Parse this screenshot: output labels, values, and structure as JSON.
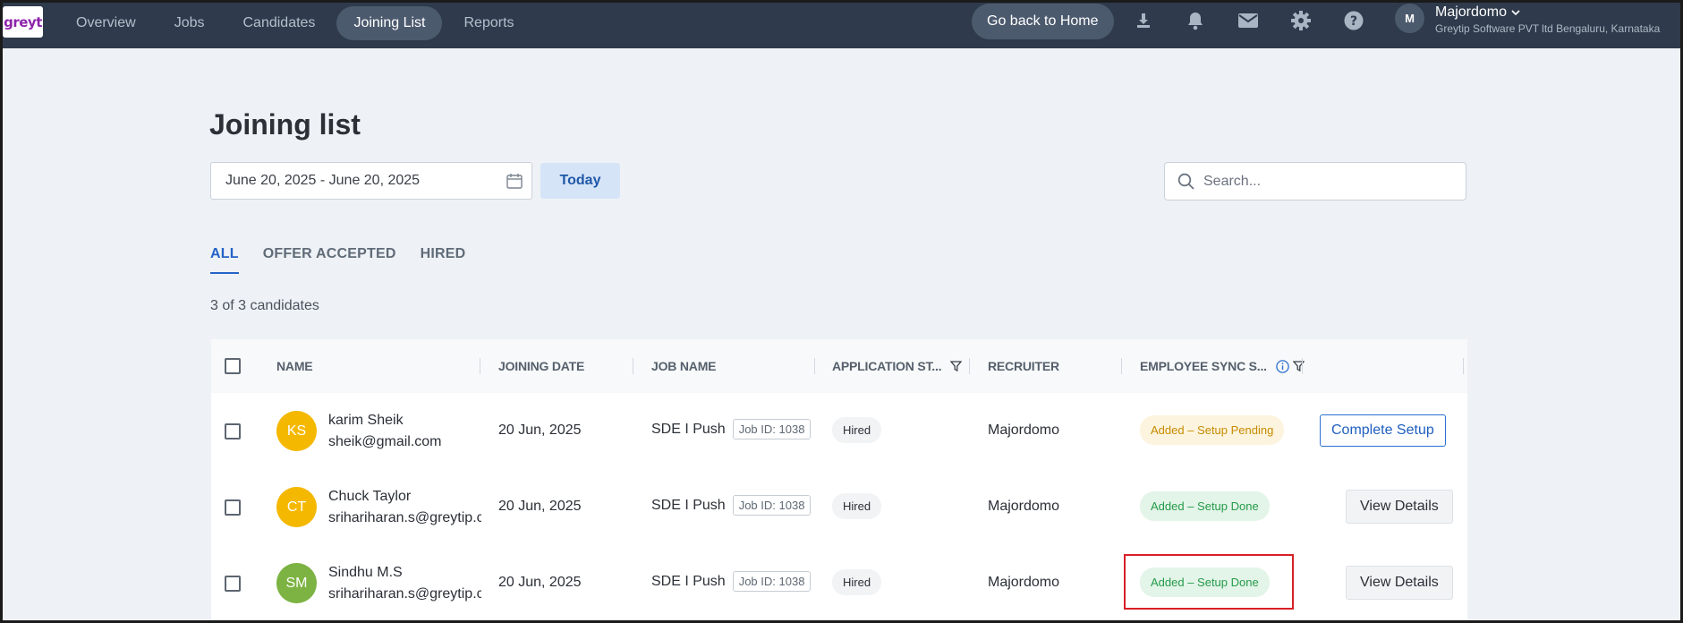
{
  "app": {
    "logo_text": "greyt",
    "nav": [
      "Overview",
      "Jobs",
      "Candidates",
      "Joining List",
      "Reports"
    ],
    "active_nav": "Joining List",
    "go_home_label": "Go back to Home",
    "icons": [
      "download-icon",
      "bell-icon",
      "mail-icon",
      "gear-icon",
      "help-icon"
    ],
    "user": {
      "initial": "M",
      "name": "Majordomo",
      "org": "Greytip Software PVT ltd Bengaluru, Karnataka"
    }
  },
  "page": {
    "title": "Joining list",
    "date_range": "June 20, 2025 - June 20, 2025",
    "today_label": "Today",
    "search_placeholder": "Search...",
    "tabs": [
      "ALL",
      "OFFER ACCEPTED",
      "HIRED"
    ],
    "active_tab": "ALL",
    "count_text": "3 of 3 candidates"
  },
  "table": {
    "columns": {
      "name": "NAME",
      "joining_date": "JOINING DATE",
      "job_name": "JOB NAME",
      "application_status": "APPLICATION ST...",
      "recruiter": "RECRUITER",
      "employee_sync": "EMPLOYEE SYNC S..."
    },
    "rows": [
      {
        "initials": "KS",
        "avatar_color": "#f5b800",
        "name": "karim Sheik",
        "email": "sheik@gmail.com",
        "joining_date": "20 Jun, 2025",
        "job_name": "SDE I Push",
        "job_id": "Job ID: 1038",
        "status": "Hired",
        "recruiter": "Majordomo",
        "sync": "Added – Setup Pending",
        "sync_type": "pending",
        "action": "Complete Setup"
      },
      {
        "initials": "CT",
        "avatar_color": "#f5b800",
        "name": "Chuck Taylor",
        "email": "srihariharan.s@greytip.com",
        "joining_date": "20 Jun, 2025",
        "job_name": "SDE I Push",
        "job_id": "Job ID: 1038",
        "status": "Hired",
        "recruiter": "Majordomo",
        "sync": "Added – Setup Done",
        "sync_type": "done",
        "action": "View Details"
      },
      {
        "initials": "SM",
        "avatar_color": "#7cb342",
        "name": "Sindhu M.S",
        "email": "srihariharan.s@greytip.com",
        "joining_date": "20 Jun, 2025",
        "job_name": "SDE I Push",
        "job_id": "Job ID: 1038",
        "status": "Hired",
        "recruiter": "Majordomo",
        "sync": "Added – Setup Done",
        "sync_type": "done",
        "action": "View Details"
      }
    ]
  },
  "colors": {
    "topbar": "#2f3b4c",
    "accent": "#2563c7",
    "highlight_box": "#d81f26"
  }
}
